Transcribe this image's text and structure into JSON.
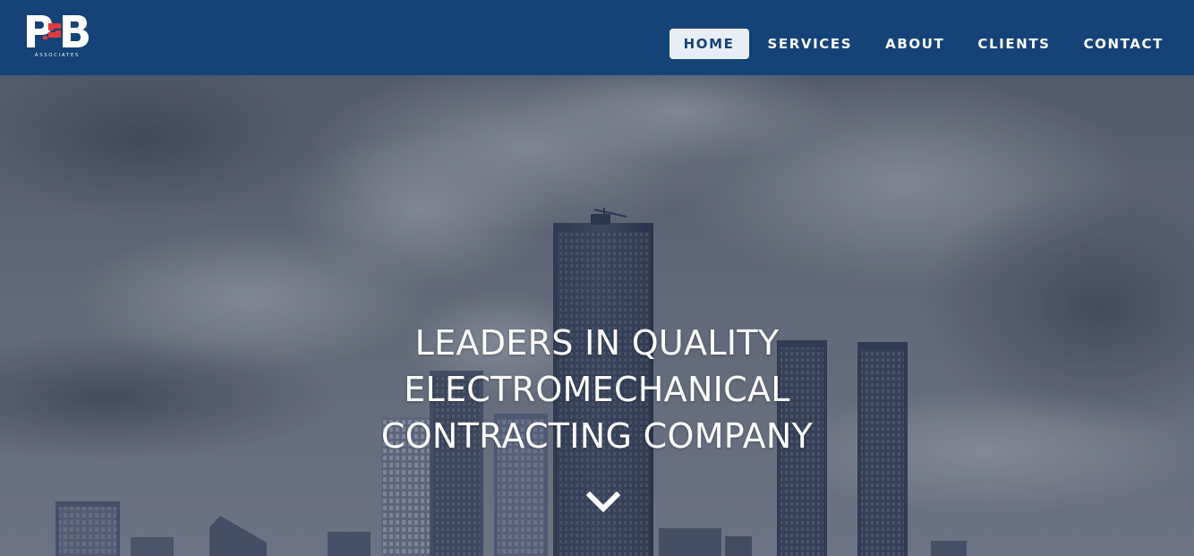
{
  "header": {
    "logo": {
      "icon": "pb-associates-logo",
      "mark_text": "P2B",
      "tagline": "ASSOCIATES"
    },
    "nav": [
      {
        "label": "HOME",
        "active": true
      },
      {
        "label": "SERVICES",
        "active": false
      },
      {
        "label": "ABOUT",
        "active": false
      },
      {
        "label": "CLIENTS",
        "active": false
      },
      {
        "label": "CONTACT",
        "active": false
      }
    ]
  },
  "hero": {
    "heading_lines": [
      "LEADERS IN QUALITY",
      "ELECTROMECHANICAL",
      "CONTRACTING COMPANY"
    ],
    "scroll_icon": "chevron-down-icon",
    "background": "city-skyline-photo"
  },
  "colors": {
    "navbar": "#154377",
    "nav_active_bg": "#e9eef6",
    "nav_active_text": "#154377",
    "logo_accent": "#e03a3e",
    "text": "#ffffff"
  }
}
